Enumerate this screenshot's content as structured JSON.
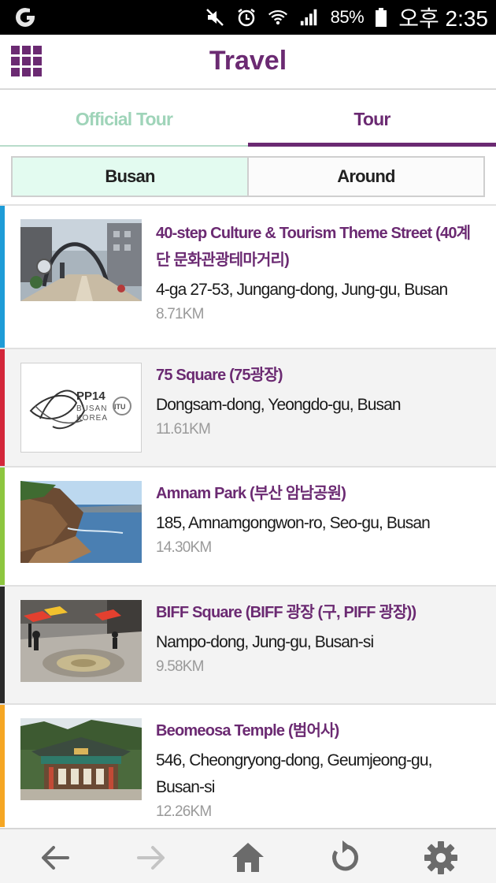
{
  "status_bar": {
    "battery": "85%",
    "time": "오후 2:35",
    "icons": [
      "app-icon",
      "mute-icon",
      "alarm-icon",
      "wifi-icon",
      "signal-icon",
      "battery-icon"
    ]
  },
  "app": {
    "title": "Travel",
    "menu_icon": "grid-menu-icon",
    "accent": "#6b2a72"
  },
  "tabs": [
    {
      "label": "Official Tour",
      "active": false
    },
    {
      "label": "Tour",
      "active": true
    }
  ],
  "segments": [
    {
      "label": "Busan",
      "selected": true
    },
    {
      "label": "Around",
      "selected": false
    }
  ],
  "places": [
    {
      "title": "40-step Culture & Tourism Theme Street (40계단 문화관광테마거리)",
      "address": "4-ga 27-53, Jungang-dong, Jung-gu, Busan",
      "distance": "8.71KM",
      "color": "#1e9cd7",
      "bg": "#ffffff",
      "thumb": "street-photo"
    },
    {
      "title": "75 Square (75광장)",
      "address": "Dongsam-dong, Yeongdo-gu, Busan",
      "distance": "11.61KM",
      "color": "#d3263a",
      "bg": "#f3f3f3",
      "thumb": "pp14-logo",
      "logo_text": [
        "PP14",
        "BUSAN",
        "KOREA",
        "ITU"
      ]
    },
    {
      "title": "Amnam Park (부산 암남공원)",
      "address": "185, Amnamgongwon-ro, Seo-gu, Busan",
      "distance": "14.30KM",
      "color": "#8dc63f",
      "bg": "#ffffff",
      "thumb": "coast-photo"
    },
    {
      "title": "BIFF Square (BIFF 광장 (구, PIFF 광장))",
      "address": "Nampo-dong, Jung-gu, Busan-si",
      "distance": "9.58KM",
      "color": "#2a2a2a",
      "bg": "#f3f3f3",
      "thumb": "square-photo"
    },
    {
      "title": "Beomeosa Temple (범어사)",
      "address": "546, Cheongryong-dong, Geumjeong-gu, Busan-si",
      "distance": "12.26KM",
      "color": "#f5a623",
      "bg": "#ffffff",
      "thumb": "temple-photo"
    }
  ],
  "bottom_nav": [
    "back-arrow-icon",
    "forward-arrow-icon",
    "home-icon",
    "refresh-icon",
    "settings-gear-icon"
  ]
}
